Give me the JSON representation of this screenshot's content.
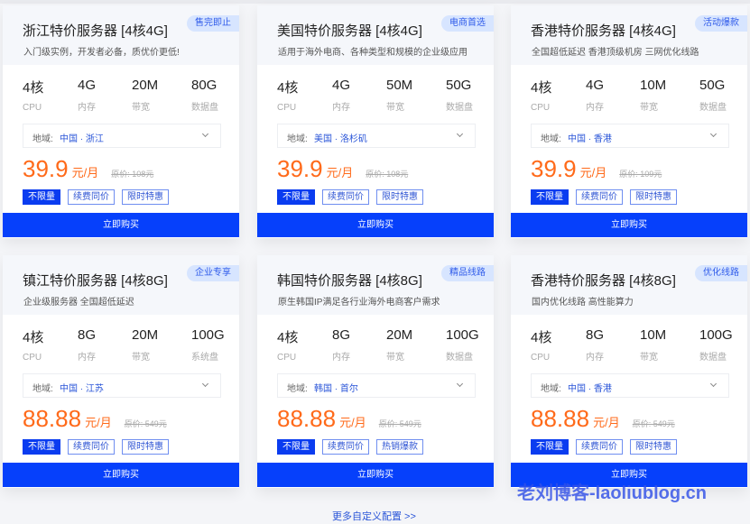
{
  "cards": [
    {
      "title": "浙江特价服务器 [4核4G]",
      "subtitle": "入门级实例，开发者必备，质优价更低!",
      "badge": "售完即止",
      "specs": [
        {
          "value": "4核",
          "label": "CPU"
        },
        {
          "value": "4G",
          "label": "内存"
        },
        {
          "value": "20M",
          "label": "带宽"
        },
        {
          "value": "80G",
          "label": "数据盘"
        }
      ],
      "region_label": "地域:",
      "region_value": "中国 · 浙江",
      "price": "39.9",
      "unit": "元/月",
      "original_price": "原价: 108元",
      "tags": [
        "不限量",
        "续费同价",
        "限时特惠"
      ],
      "buy_label": "立即购买"
    },
    {
      "title": "美国特价服务器 [4核4G]",
      "subtitle": "适用于海外电商、各种类型和规模的企业级应用",
      "badge": "电商首选",
      "specs": [
        {
          "value": "4核",
          "label": "CPU"
        },
        {
          "value": "4G",
          "label": "内存"
        },
        {
          "value": "50M",
          "label": "带宽"
        },
        {
          "value": "50G",
          "label": "数据盘"
        }
      ],
      "region_label": "地域:",
      "region_value": "美国 · 洛杉矶",
      "price": "39.9",
      "unit": "元/月",
      "original_price": "原价: 108元",
      "tags": [
        "不限量",
        "续费同价",
        "限时特惠"
      ],
      "buy_label": "立即购买"
    },
    {
      "title": "香港特价服务器 [4核4G]",
      "subtitle": "全国超低延迟 香港顶级机房 三网优化线路",
      "badge": "活动爆款",
      "specs": [
        {
          "value": "4核",
          "label": "CPU"
        },
        {
          "value": "4G",
          "label": "内存"
        },
        {
          "value": "10M",
          "label": "带宽"
        },
        {
          "value": "50G",
          "label": "数据盘"
        }
      ],
      "region_label": "地域:",
      "region_value": "中国 · 香港",
      "price": "39.9",
      "unit": "元/月",
      "original_price": "原价: 109元",
      "tags": [
        "不限量",
        "续费同价",
        "限时特惠"
      ],
      "buy_label": "立即购买"
    },
    {
      "title": "镇江特价服务器 [4核8G]",
      "subtitle": "企业级服务器 全国超低延迟",
      "badge": "企业专享",
      "specs": [
        {
          "value": "4核",
          "label": "CPU"
        },
        {
          "value": "8G",
          "label": "内存"
        },
        {
          "value": "20M",
          "label": "带宽"
        },
        {
          "value": "100G",
          "label": "系统盘"
        }
      ],
      "region_label": "地域:",
      "region_value": "中国 · 江苏",
      "price": "88.88",
      "unit": "元/月",
      "original_price": "原价: 549元",
      "tags": [
        "不限量",
        "续费同价",
        "限时特惠"
      ],
      "buy_label": "立即购买"
    },
    {
      "title": "韩国特价服务器 [4核8G]",
      "subtitle": "原生韩国IP满足各行业海外电商客户需求",
      "badge": "精品线路",
      "specs": [
        {
          "value": "4核",
          "label": "CPU"
        },
        {
          "value": "8G",
          "label": "内存"
        },
        {
          "value": "20M",
          "label": "带宽"
        },
        {
          "value": "100G",
          "label": "数据盘"
        }
      ],
      "region_label": "地域:",
      "region_value": "韩国 · 首尔",
      "price": "88.88",
      "unit": "元/月",
      "original_price": "原价: 549元",
      "tags": [
        "不限量",
        "续费同价",
        "热销爆款"
      ],
      "buy_label": "立即购买"
    },
    {
      "title": "香港特价服务器 [4核8G]",
      "subtitle": "国内优化线路 高性能算力",
      "badge": "优化线路",
      "specs": [
        {
          "value": "4核",
          "label": "CPU"
        },
        {
          "value": "8G",
          "label": "内存"
        },
        {
          "value": "10M",
          "label": "带宽"
        },
        {
          "value": "100G",
          "label": "数据盘"
        }
      ],
      "region_label": "地域:",
      "region_value": "中国 · 香港",
      "price": "88.88",
      "unit": "元/月",
      "original_price": "原价: 549元",
      "tags": [
        "不限量",
        "续费同价",
        "限时特惠"
      ],
      "buy_label": "立即购买"
    }
  ],
  "more_link": "更多自定义配置 >>",
  "watermark": "老刘博客-laoliublog.cn",
  "colors": {
    "accent_blue": "#0640fb",
    "price_orange": "#ff6a1a",
    "badge_bg": "#d7e5ff",
    "link_blue": "#2a55d8"
  }
}
